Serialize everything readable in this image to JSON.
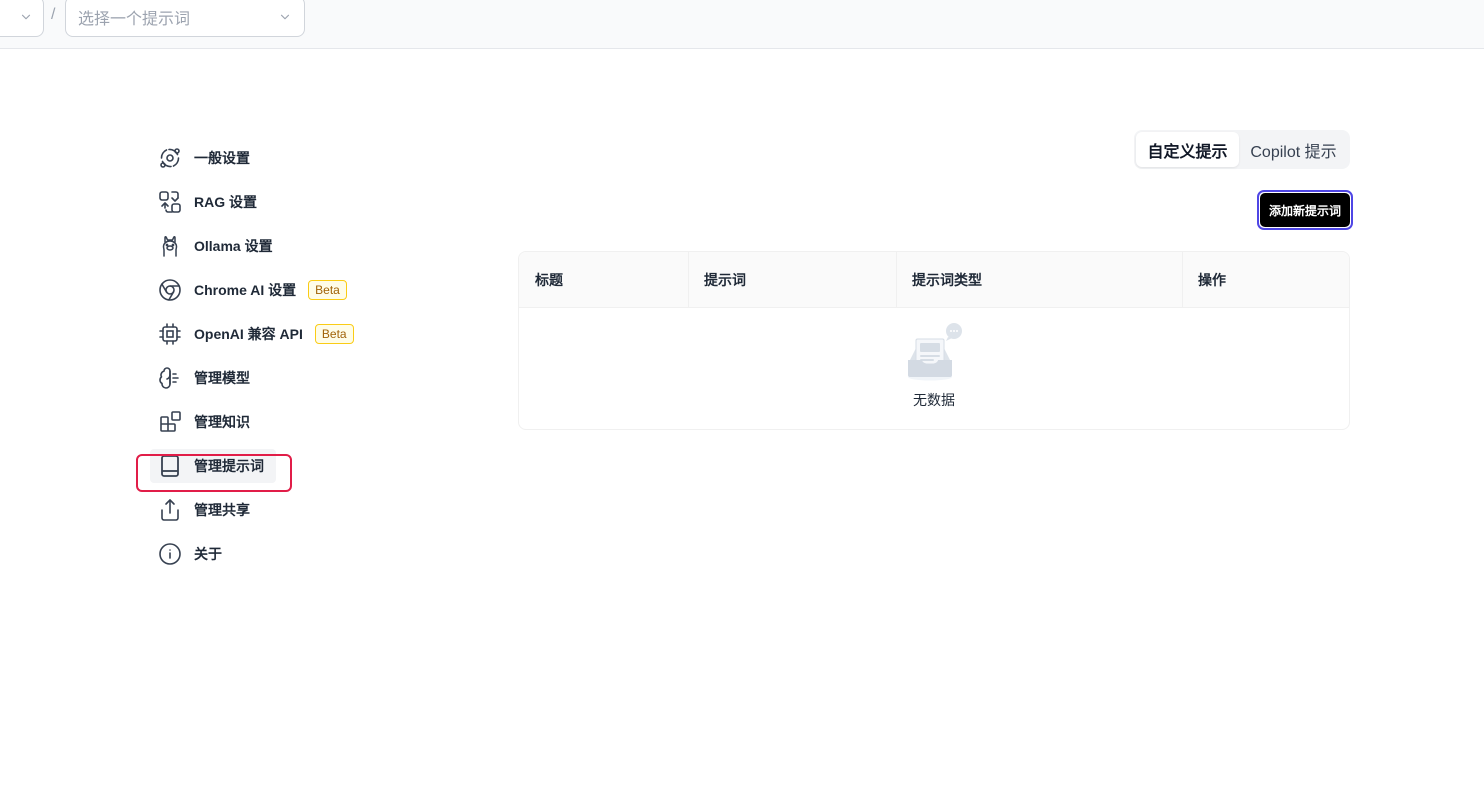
{
  "topbar": {
    "separator": "/",
    "prompt_select_placeholder": "选择一个提示词"
  },
  "sidebar": {
    "items": [
      {
        "label": "一般设置",
        "icon": "orbit-icon"
      },
      {
        "label": "RAG 设置",
        "icon": "combine-icon"
      },
      {
        "label": "Ollama 设置",
        "icon": "ollama-icon"
      },
      {
        "label": "Chrome AI 设置",
        "icon": "chrome-icon",
        "badge": "Beta"
      },
      {
        "label": "OpenAI 兼容 API",
        "icon": "cpu-icon",
        "badge": "Beta"
      },
      {
        "label": "管理模型",
        "icon": "brain-icon"
      },
      {
        "label": "管理知识",
        "icon": "blocks-icon"
      },
      {
        "label": "管理提示词",
        "icon": "book-icon",
        "active": true
      },
      {
        "label": "管理共享",
        "icon": "share-icon"
      },
      {
        "label": "关于",
        "icon": "info-icon"
      }
    ]
  },
  "tabs": {
    "custom": "自定义提示",
    "copilot": "Copilot 提示"
  },
  "add_button": "添加新提示词",
  "table": {
    "columns": [
      "标题",
      "提示词",
      "提示词类型",
      "操作"
    ],
    "empty_text": "无数据"
  },
  "colors": {
    "highlight": "#e11d48",
    "button_bg": "#000000",
    "button_ring": "#4f46e5",
    "beta_border": "#facc15"
  }
}
